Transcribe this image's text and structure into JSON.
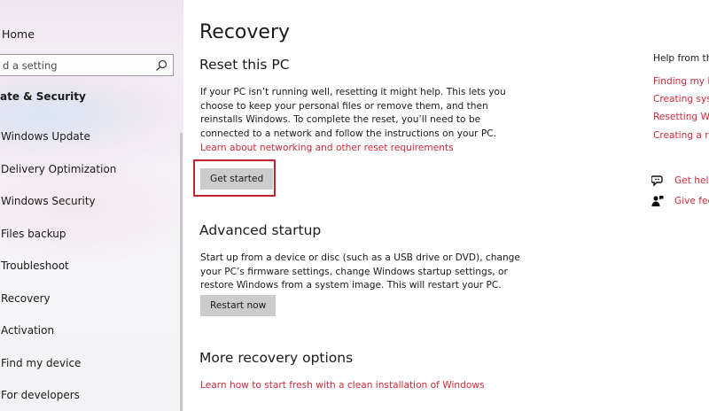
{
  "sidebar": {
    "home_label": "Home",
    "search_placeholder": "d a setting",
    "search_icon": "search-icon",
    "section_title": "ate & Security",
    "items": [
      {
        "label": "Windows Update"
      },
      {
        "label": "Delivery Optimization"
      },
      {
        "label": "Windows Security"
      },
      {
        "label": "Files backup"
      },
      {
        "label": "Troubleshoot"
      },
      {
        "label": "Recovery"
      },
      {
        "label": "Activation"
      },
      {
        "label": "Find my device"
      },
      {
        "label": "For developers"
      }
    ]
  },
  "main": {
    "title": "Recovery",
    "reset": {
      "heading": "Reset this PC",
      "description": "If your PC isn’t running well, resetting it might help. This lets you choose to keep your personal files or remove them, and then reinstalls Windows. To complete the reset, you’ll need to be connected to a network and follow the instructions on your PC.",
      "link": "Learn about networking and other reset requirements",
      "button": "Get started"
    },
    "advanced": {
      "heading": "Advanced startup",
      "description": "Start up from a device or disc (such as a USB drive or DVD), change your PC’s firmware settings, change Windows startup settings, or restore Windows from a system image. This will restart your PC.",
      "button": "Restart now"
    },
    "more": {
      "heading": "More recovery options",
      "link": "Learn how to start fresh with a clean installation of Windows"
    }
  },
  "rail": {
    "heading": "Help from the",
    "links": [
      "Finding my Bi",
      "Creating syste",
      "Resetting Win",
      "Creating a rec"
    ],
    "get_help": "Get help",
    "give_feedback": "Give fee",
    "get_help_icon": "chat-help-icon",
    "feedback_icon": "feedback-person-icon"
  },
  "colors": {
    "accent_link": "#d02a38",
    "highlight_border": "#c4242f",
    "button_bg": "#cccccc"
  }
}
